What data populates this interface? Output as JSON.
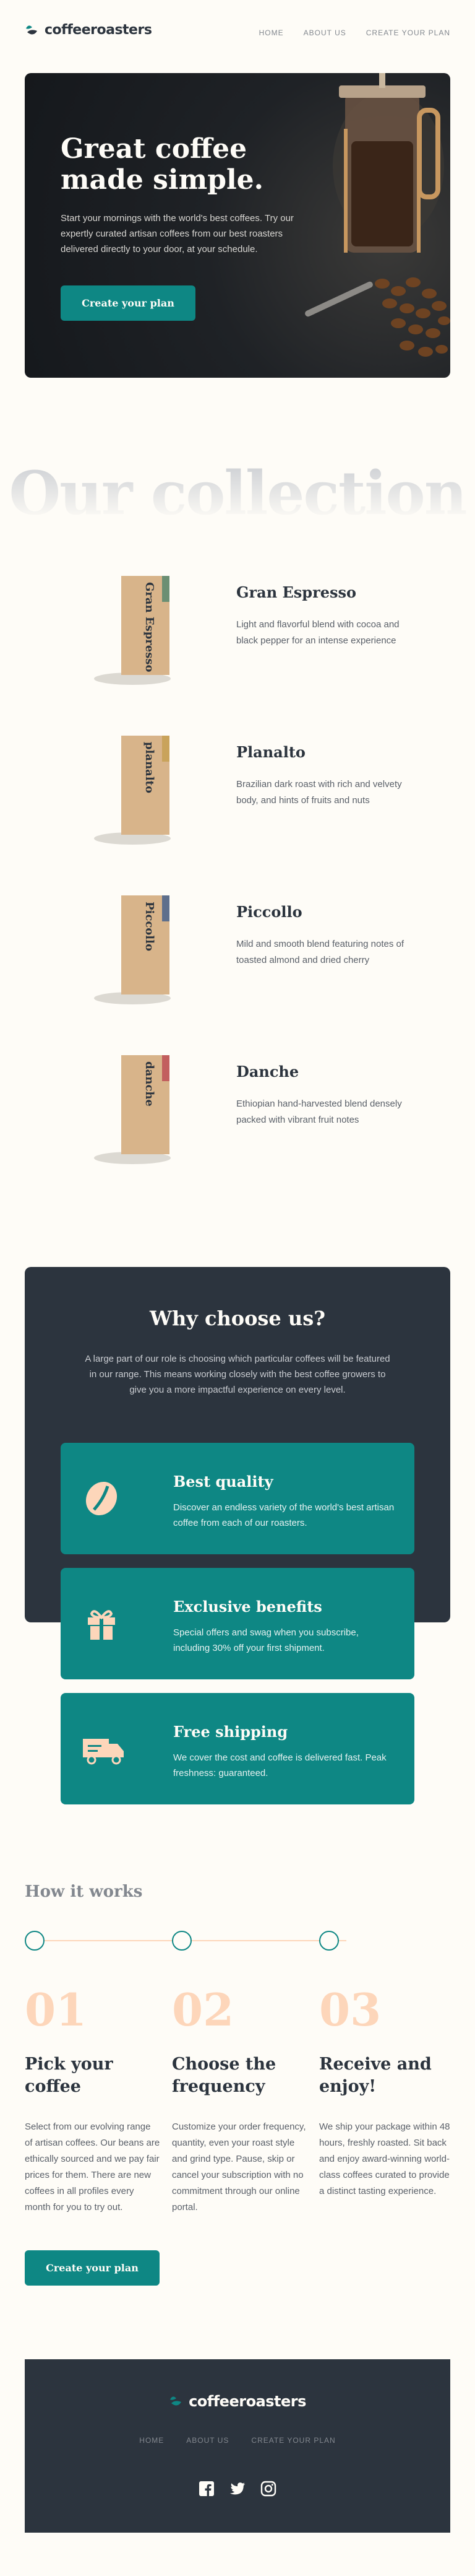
{
  "header": {
    "logo_text": "coffeeroasters",
    "nav": [
      "HOME",
      "ABOUT US",
      "CREATE YOUR PLAN"
    ]
  },
  "hero": {
    "title": "Great coffee made simple.",
    "text": "Start your mornings with the world's best coffees. Try our expertly curated artisan coffees from our best roasters delivered directly to your door, at your schedule.",
    "button": "Create your plan"
  },
  "collection": {
    "title": "Our collection",
    "products": [
      {
        "name": "Gran Espresso",
        "bag_label": "Gran Espresso",
        "desc": "Light and flavorful blend with cocoa and black pepper for an intense experience",
        "stripe": "#6b8f73"
      },
      {
        "name": "Planalto",
        "bag_label": "planalto",
        "desc": "Brazilian dark roast with rich and velvety body, and hints of fruits and nuts",
        "stripe": "#c9a35b"
      },
      {
        "name": "Piccollo",
        "bag_label": "Piccollo",
        "desc": "Mild and smooth blend featuring notes of toasted almond and dried cherry",
        "stripe": "#5e6f8c"
      },
      {
        "name": "Danche",
        "bag_label": "danche",
        "desc": "Ethiopian hand-harvested blend densely packed with vibrant fruit notes",
        "stripe": "#c25e5e"
      }
    ]
  },
  "why": {
    "title": "Why choose us?",
    "text": "A large part of our role is choosing which particular coffees will be featured in our range. This means working closely with the best coffee growers to give you a more impactful experience on every level.",
    "features": [
      {
        "icon": "coffee-bean-icon",
        "title": "Best quality",
        "text": "Discover an endless variety of the world's best artisan coffee from each of our roasters."
      },
      {
        "icon": "gift-icon",
        "title": "Exclusive benefits",
        "text": "Special offers and swag when you subscribe, including 30% off your first shipment."
      },
      {
        "icon": "truck-icon",
        "title": "Free shipping",
        "text": "We cover the cost and coffee is delivered fast. Peak freshness: guaranteed."
      }
    ]
  },
  "how": {
    "heading": "How it works",
    "steps": [
      {
        "num": "01",
        "title": "Pick your coffee",
        "text": "Select from our evolving range of artisan coffees. Our beans are ethically sourced and we pay fair prices for them. There are new coffees in all profiles every month for you to try out."
      },
      {
        "num": "02",
        "title": "Choose the frequency",
        "text": "Customize your order frequency, quantity, even your roast style and grind type. Pause, skip or cancel your subscription with no commitment through our online portal."
      },
      {
        "num": "03",
        "title": "Receive and enjoy!",
        "text": "We ship your package within 48 hours, freshly roasted. Sit back and enjoy award-winning world-class coffees curated to provide a distinct tasting experience."
      }
    ],
    "button": "Create your plan"
  },
  "footer": {
    "logo_text": "coffeeroasters",
    "nav": [
      "HOME",
      "ABOUT US",
      "CREATE YOUR PLAN"
    ],
    "social": [
      "facebook-icon",
      "twitter-icon",
      "instagram-icon"
    ]
  },
  "colors": {
    "accent": "#0e8784",
    "dark": "#2c343e",
    "cream": "#fefcf7",
    "peach": "#fdd6ba"
  }
}
